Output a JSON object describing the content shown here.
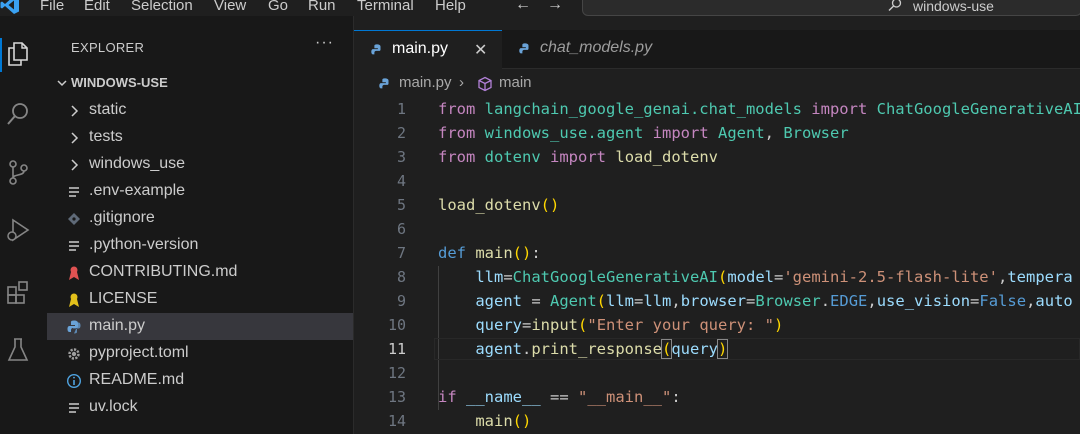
{
  "menu": {
    "items": [
      "File",
      "Edit",
      "Selection",
      "View",
      "Go",
      "Run",
      "Terminal",
      "Help"
    ],
    "back_icon": "arrow-left-icon",
    "forward_icon": "arrow-right-icon"
  },
  "command_center": {
    "text": "windows-use",
    "icon": "search-icon"
  },
  "activity_bar": {
    "items": [
      "explorer",
      "search",
      "source-control",
      "run-and-debug",
      "extensions",
      "testing"
    ],
    "active": "explorer"
  },
  "sidebar": {
    "title": "EXPLORER",
    "more_label": "···",
    "workspace": "WINDOWS-USE",
    "items": [
      {
        "label": "static",
        "icon": "chevron-right-icon",
        "type": "folder"
      },
      {
        "label": "tests",
        "icon": "chevron-right-icon",
        "type": "folder"
      },
      {
        "label": "windows_use",
        "icon": "chevron-right-icon",
        "type": "folder"
      },
      {
        "label": ".env-example",
        "icon": "lines-file-icon",
        "type": "file"
      },
      {
        "label": ".gitignore",
        "icon": "git-file-icon",
        "type": "file"
      },
      {
        "label": ".python-version",
        "icon": "lines-file-icon",
        "type": "file"
      },
      {
        "label": "CONTRIBUTING.md",
        "icon": "ribbon-icon-red",
        "type": "file"
      },
      {
        "label": "LICENSE",
        "icon": "ribbon-icon-yellow",
        "type": "file"
      },
      {
        "label": "main.py",
        "icon": "python-icon",
        "type": "file",
        "selected": true
      },
      {
        "label": "pyproject.toml",
        "icon": "gear-icon",
        "type": "file"
      },
      {
        "label": "README.md",
        "icon": "info-icon",
        "type": "file"
      },
      {
        "label": "uv.lock",
        "icon": "lines-file-icon",
        "type": "file"
      }
    ]
  },
  "tabs": [
    {
      "label": "main.py",
      "active": true,
      "close": "✕"
    },
    {
      "label": "chat_models.py",
      "active": false
    }
  ],
  "breadcrumb": {
    "file": "main.py",
    "separator": "›",
    "symbol": "main"
  },
  "editor": {
    "current_line": 11,
    "lines": [
      {
        "n": "1",
        "text": "from langchain_google_genai.chat_models import ChatGoogleGenerativeAI"
      },
      {
        "n": "2",
        "text": "from windows_use.agent import Agent, Browser"
      },
      {
        "n": "3",
        "text": "from dotenv import load_dotenv"
      },
      {
        "n": "4",
        "text": ""
      },
      {
        "n": "5",
        "text": "load_dotenv()"
      },
      {
        "n": "6",
        "text": ""
      },
      {
        "n": "7",
        "text": "def main():"
      },
      {
        "n": "8",
        "text": "    llm=ChatGoogleGenerativeAI(model='gemini-2.5-flash-lite',tempera"
      },
      {
        "n": "9",
        "text": "    agent = Agent(llm=llm,browser=Browser.EDGE,use_vision=False,auto"
      },
      {
        "n": "10",
        "text": "    query=input(\"Enter your query: \")"
      },
      {
        "n": "11",
        "text": "    agent.print_response(query)"
      },
      {
        "n": "12",
        "text": ""
      },
      {
        "n": "13",
        "text": "if __name__ == \"__main__\":"
      },
      {
        "n": "14",
        "text": "    main()"
      }
    ]
  },
  "colors": {
    "accent": "#0078d4",
    "keyword": "#c586c0",
    "function": "#dcdcaa",
    "class": "#4ec9b0",
    "variable": "#9cdcfe",
    "string": "#ce9178"
  }
}
